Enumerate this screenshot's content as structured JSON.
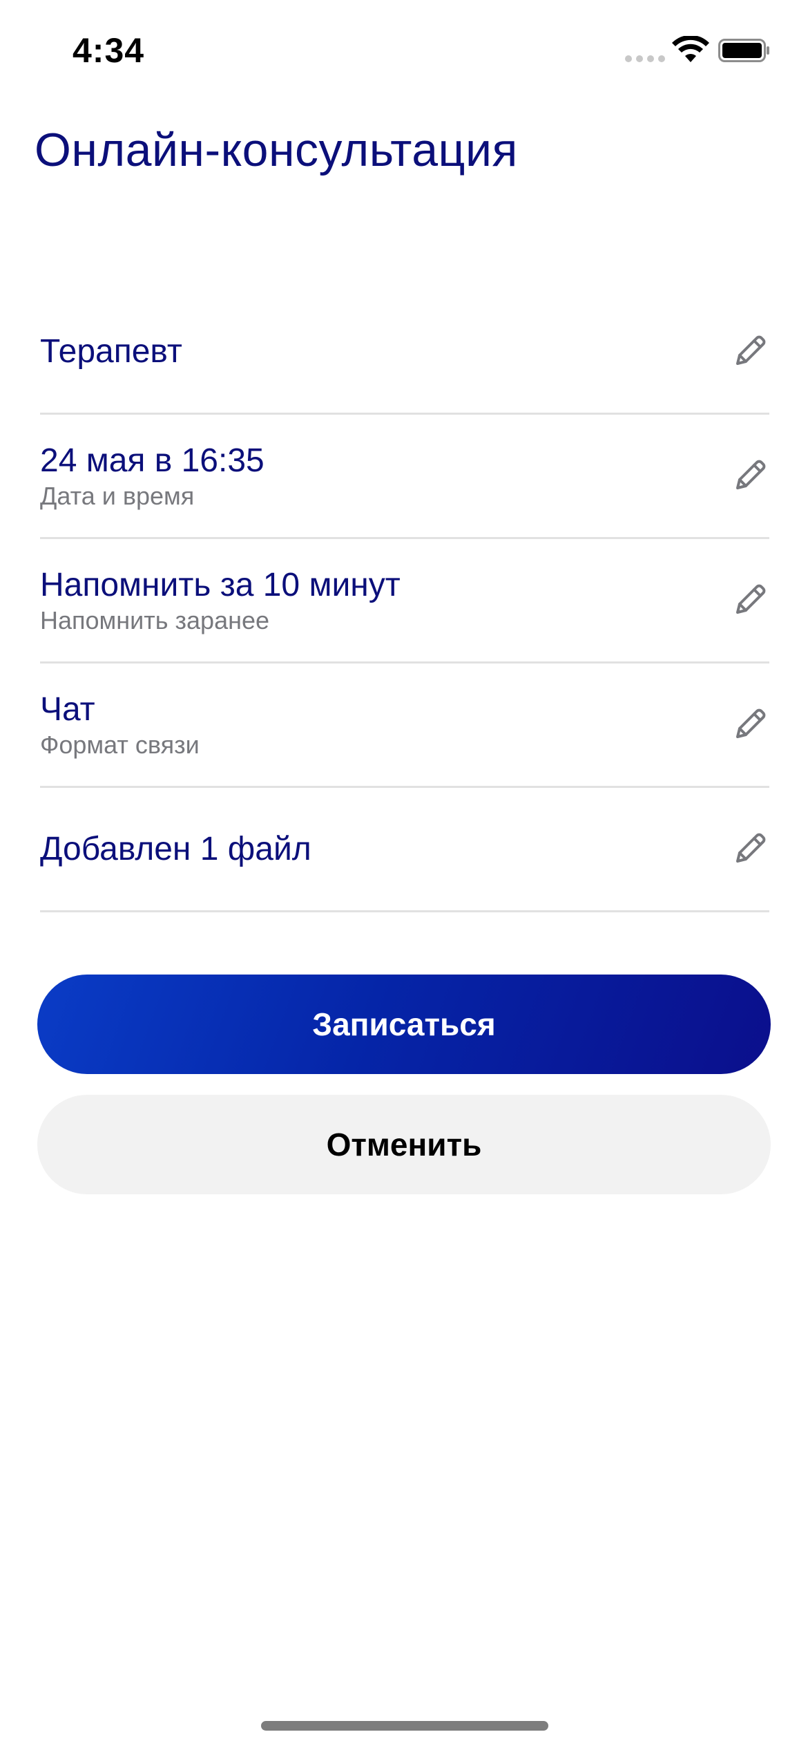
{
  "status_bar": {
    "time": "4:34"
  },
  "title": "Онлайн-консультация",
  "rows": [
    {
      "value": "Терапевт",
      "label": "",
      "icon": "pencil-icon"
    },
    {
      "value": "24 мая в 16:35",
      "label": "Дата и время",
      "icon": "pencil-icon"
    },
    {
      "value": "Напомнить за 10 минут",
      "label": "Напомнить заранее",
      "icon": "pencil-icon"
    },
    {
      "value": "Чат",
      "label": "Формат связи",
      "icon": "pencil-icon"
    },
    {
      "value": "Добавлен 1 файл",
      "label": "",
      "icon": "pencil-icon"
    }
  ],
  "buttons": {
    "submit": "Записаться",
    "cancel": "Отменить"
  },
  "colors": {
    "primary_text": "#0b0f7a",
    "secondary_text": "#77787d",
    "button_gradient_start": "#0a3cc6",
    "button_gradient_end": "#0b0f8c",
    "cancel_bg": "#f2f2f2",
    "divider": "#e1e1e1"
  }
}
